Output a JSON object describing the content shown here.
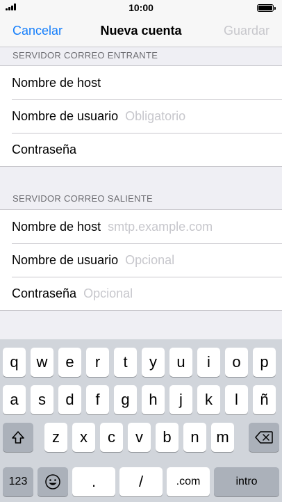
{
  "status": {
    "time": "10:00"
  },
  "nav": {
    "cancel": "Cancelar",
    "title": "Nueva cuenta",
    "save": "Guardar"
  },
  "incoming": {
    "header": "SERVIDOR CORREO ENTRANTE",
    "rows": [
      {
        "label": "Nombre de host",
        "placeholder": ""
      },
      {
        "label": "Nombre de usuario",
        "placeholder": "Obligatorio"
      },
      {
        "label": "Contraseña",
        "placeholder": ""
      }
    ]
  },
  "outgoing": {
    "header": "SERVIDOR CORREO SALIENTE",
    "rows": [
      {
        "label": "Nombre de host",
        "placeholder": "smtp.example.com"
      },
      {
        "label": "Nombre de usuario",
        "placeholder": "Opcional"
      },
      {
        "label": "Contraseña",
        "placeholder": "Opcional"
      }
    ]
  },
  "keyboard": {
    "row1": [
      "q",
      "w",
      "e",
      "r",
      "t",
      "y",
      "u",
      "i",
      "o",
      "p"
    ],
    "row2": [
      "a",
      "s",
      "d",
      "f",
      "g",
      "h",
      "j",
      "k",
      "l",
      "ñ"
    ],
    "row3": [
      "z",
      "x",
      "c",
      "v",
      "b",
      "n",
      "m"
    ],
    "numbers": "123",
    "dot": ".",
    "slash": "/",
    "com": ".com",
    "enter": "intro",
    "shift_icon": "shift-arrow-icon",
    "backspace_icon": "backspace-icon",
    "emoji_icon": "emoji-icon"
  },
  "colors": {
    "accent": "#147efb",
    "placeholder": "#c7c7cc",
    "background": "#efeff4"
  }
}
